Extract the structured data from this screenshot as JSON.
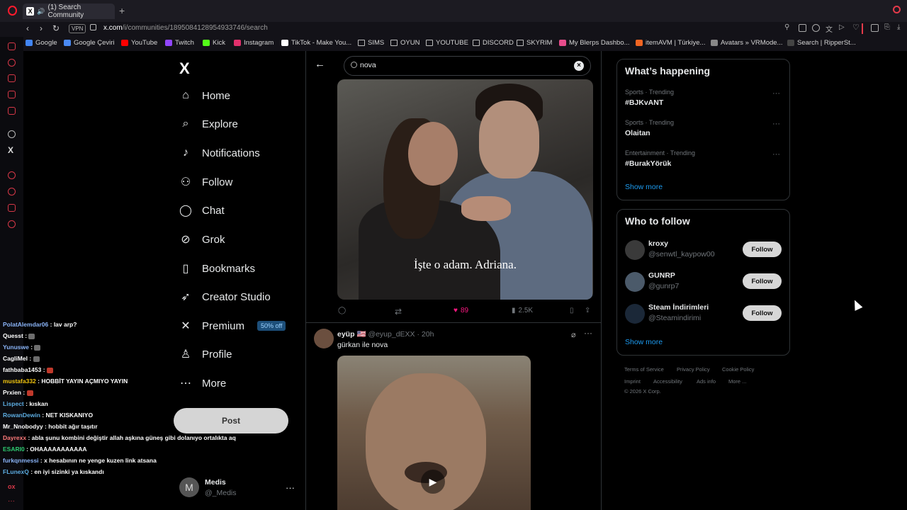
{
  "browser": {
    "tab_title": "(1) Search Community",
    "url_host": "x.com",
    "url_path": "/i/communities/1895084128954933746/search",
    "vpn_label": "VPN",
    "new_tab": "+",
    "bookmarks": [
      {
        "label": "Google",
        "color": "#4285f4"
      },
      {
        "label": "Google Çeviri",
        "color": "#4a8af4"
      },
      {
        "label": "YouTube",
        "color": "#ff0000"
      },
      {
        "label": "Twitch",
        "color": "#9146ff"
      },
      {
        "label": "Kick",
        "color": "#53fc18"
      },
      {
        "label": "Instagram",
        "color": "#e1306c"
      },
      {
        "label": "TikTok - Make You...",
        "color": "#ffffff"
      },
      {
        "label": "SIMS",
        "color": "folder"
      },
      {
        "label": "OYUN",
        "color": "folder"
      },
      {
        "label": "YOUTUBE",
        "color": "folder"
      },
      {
        "label": "DISCORD",
        "color": "folder"
      },
      {
        "label": "SKYRIM",
        "color": "folder"
      },
      {
        "label": "My Blerps Dashbo...",
        "color": "#e74c8b"
      },
      {
        "label": "itemAVM | Türkiye...",
        "color": "#f26522"
      },
      {
        "label": "Avatars » VRMode...",
        "color": "#888888"
      },
      {
        "label": "Search | RipperSt...",
        "color": "#444444"
      }
    ]
  },
  "chat": [
    {
      "user": "PolatAlemdar06",
      "msg": "lav arp?",
      "color": "#8ab4f8"
    },
    {
      "user": "Quesst",
      "msg": "",
      "color": "#ffffff",
      "emote": "#6d6d6d"
    },
    {
      "user": "Yunuswe",
      "msg": "",
      "color": "#8ab4f8",
      "emote": "#6d6d6d"
    },
    {
      "user": "CagliMel",
      "msg": "",
      "color": "#ffffff",
      "emote": "#6d6d6d"
    },
    {
      "user": "fathbaba1453",
      "msg": "",
      "color": "#ffffff",
      "emote": "#c0392b"
    },
    {
      "user": "mustafa332",
      "msg": "HOBBİT YAYIN AÇMIYO YAYIN",
      "color": "#f1c40f"
    },
    {
      "user": "Prxien",
      "msg": "",
      "color": "#ffffff",
      "emote": "#c0392b"
    },
    {
      "user": "Lispect",
      "msg": "kıskan",
      "color": "#5dade2"
    },
    {
      "user": "RowanDewin",
      "msg": "NET KISKANIYO",
      "color": "#5dade2"
    },
    {
      "user": "Mr_Nnobodyy",
      "msg": "hobbit ağır taşıtır",
      "color": "#ffffff"
    },
    {
      "user": "Dayrexx",
      "msg": "abla şunu kombini değiştir allah aşkına güneş gibi dolanıyo ortalıkta aq",
      "color": "#ff7b7b"
    },
    {
      "user": "ESARI0",
      "msg": "OHAAAAAAAAAAA",
      "color": "#2ecc71"
    },
    {
      "user": "furkqnmessi",
      "msg": "x hesabının ne yenge kuzen link atsana",
      "color": "#8ab4f8"
    },
    {
      "user": "FLunexQ",
      "msg": "en iyi sizinki ya kıskandı",
      "color": "#5dade2"
    }
  ],
  "nav": {
    "logo": "X",
    "items": [
      {
        "label": "Home",
        "icon": "home-icon"
      },
      {
        "label": "Explore",
        "icon": "search-icon"
      },
      {
        "label": "Notifications",
        "icon": "bell-icon"
      },
      {
        "label": "Follow",
        "icon": "person-add-icon"
      },
      {
        "label": "Chat",
        "icon": "chat-icon"
      },
      {
        "label": "Grok",
        "icon": "grok-icon"
      },
      {
        "label": "Bookmarks",
        "icon": "bookmark-icon"
      },
      {
        "label": "Creator Studio",
        "icon": "rocket-icon"
      },
      {
        "label": "Premium",
        "icon": "x-icon"
      },
      {
        "label": "Profile",
        "icon": "person-icon"
      },
      {
        "label": "More",
        "icon": "more-circle-icon"
      }
    ],
    "premium_badge": "50% off",
    "post_label": "Post",
    "account": {
      "initial": "M",
      "name": "Medis",
      "handle": "@_Medis"
    }
  },
  "search": {
    "query": "nova"
  },
  "tweet1": {
    "caption": "İşte o adam. Adriana.",
    "likes": "89",
    "views": "2.5K"
  },
  "tweet2": {
    "name": "eyüp",
    "flag": "🇺🇸",
    "handle": "@eyup_dEXX",
    "time": "20h",
    "text": "gürkan ile nova"
  },
  "whats_happening": {
    "title": "What’s happening",
    "trends": [
      {
        "meta": "Sports · Trending",
        "name": "#BJKvANT"
      },
      {
        "meta": "Sports · Trending",
        "name": "Olaitan"
      },
      {
        "meta": "Entertainment · Trending",
        "name": "#BurakYörük"
      }
    ],
    "show_more": "Show more"
  },
  "who_to_follow": {
    "title": "Who to follow",
    "accounts": [
      {
        "name": "kroxy",
        "handle": "@senwtl_kaypow00",
        "color": "#3a3a3a"
      },
      {
        "name": "GUNRP",
        "handle": "@gunrp7",
        "color": "#4b5a6a"
      },
      {
        "name": "Steam İndirimleri",
        "handle": "@Steamindirimi",
        "color": "#1b2838"
      }
    ],
    "follow_label": "Follow",
    "show_more": "Show more"
  },
  "footer": {
    "links": [
      "Terms of Service",
      "Privacy Policy",
      "Cookie Policy",
      "Imprint",
      "Accessibility",
      "Ads info",
      "More ..."
    ],
    "copyright": "© 2026 X Corp."
  }
}
